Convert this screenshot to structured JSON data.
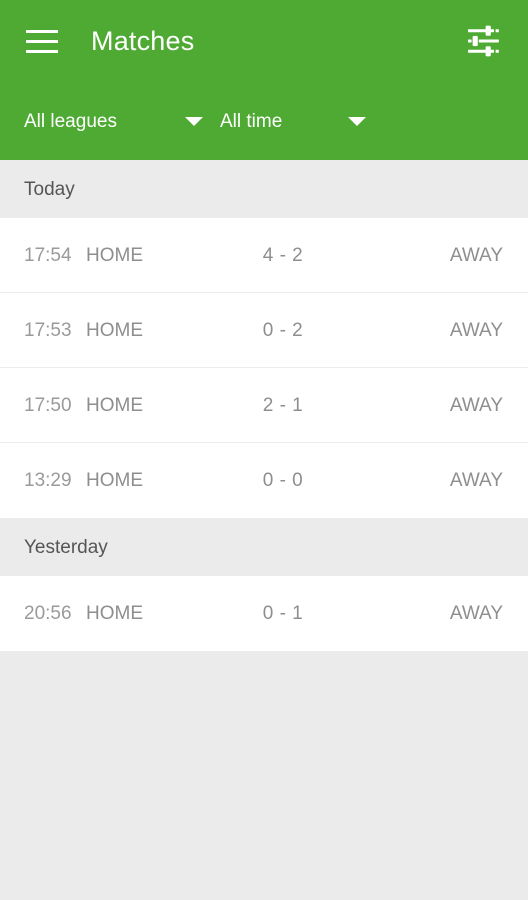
{
  "app": {
    "title": "Matches",
    "accent_color": "#4eaa33",
    "background_color": "#ebebeb",
    "surface_color": "#ffffff"
  },
  "appbar": {
    "menu_icon": "hamburger-menu-icon",
    "title": "Matches",
    "action_icon": "tune-filter-icon"
  },
  "filters": [
    {
      "label": "All leagues",
      "icon": "chevron-down-icon"
    },
    {
      "label": "All time",
      "icon": "chevron-down-icon"
    }
  ],
  "sections": [
    {
      "header": "Today",
      "matches": [
        {
          "time": "17:54",
          "home": "HOME",
          "score": "4 - 2",
          "away": "AWAY"
        },
        {
          "time": "17:53",
          "home": "HOME",
          "score": "0 - 2",
          "away": "AWAY"
        },
        {
          "time": "17:50",
          "home": "HOME",
          "score": "2 - 1",
          "away": "AWAY"
        },
        {
          "time": "13:29",
          "home": "HOME",
          "score": "0 - 0",
          "away": "AWAY"
        }
      ]
    },
    {
      "header": "Yesterday",
      "matches": [
        {
          "time": "20:56",
          "home": "HOME",
          "score": "0 - 1",
          "away": "AWAY"
        }
      ]
    }
  ]
}
